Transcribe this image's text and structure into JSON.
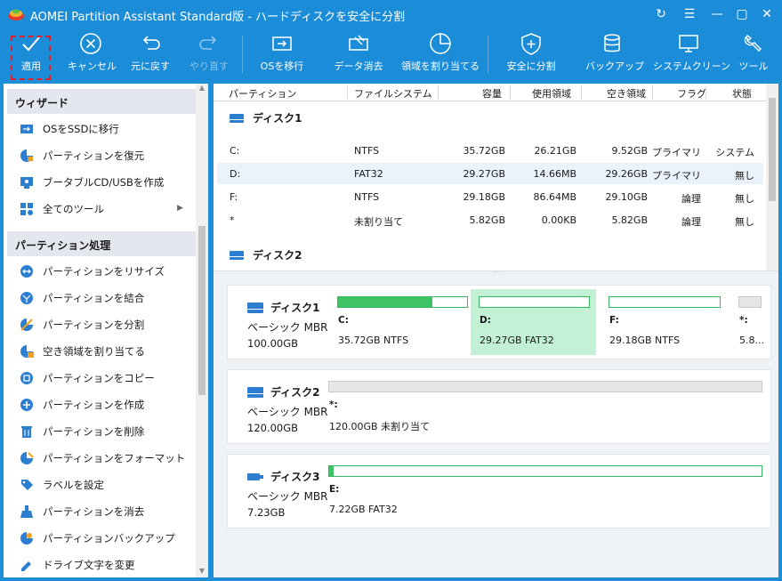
{
  "window": {
    "title": "AOMEI Partition Assistant Standard版 - ハードディスクを安全に分割",
    "brand_color": "#1b8cd8",
    "buttons": [
      "refresh-icon",
      "menu-icon",
      "minimize-icon",
      "maximize-icon",
      "close-icon"
    ]
  },
  "toolbar": {
    "apply": "適用",
    "cancel": "キャンセル",
    "undo": "元に戻す",
    "redo": "やり直す",
    "migrate_os": "OSを移行",
    "wipe_data": "データ消去",
    "allocate_space": "領域を割り当てる",
    "safe_split": "安全に分割",
    "backup": "バックアップ",
    "system_clean": "システムクリーン",
    "tools": "ツール"
  },
  "sidebar": {
    "wizard_title": "ウィザード",
    "wizard_items": [
      {
        "label": "OSをSSDに移行",
        "icon": "migrate-icon"
      },
      {
        "label": "パーティションを復元",
        "icon": "recover-icon"
      },
      {
        "label": "ブータブルCD/USBを作成",
        "icon": "bootable-icon"
      },
      {
        "label": "全てのツール",
        "icon": "tools-grid-icon"
      }
    ],
    "partition_title": "パーティション処理",
    "partition_items": [
      {
        "label": "パーティションをリサイズ",
        "icon": "resize-icon"
      },
      {
        "label": "パーティションを結合",
        "icon": "merge-icon"
      },
      {
        "label": "パーティションを分割",
        "icon": "split-icon"
      },
      {
        "label": "空き領域を割り当てる",
        "icon": "allocate-icon"
      },
      {
        "label": "パーティションをコピー",
        "icon": "copy-icon"
      },
      {
        "label": "パーティションを作成",
        "icon": "create-icon"
      },
      {
        "label": "パーティションを削除",
        "icon": "delete-icon"
      },
      {
        "label": "パーティションをフォーマット",
        "icon": "format-icon"
      },
      {
        "label": "ラベルを設定",
        "icon": "label-icon"
      },
      {
        "label": "パーティションを消去",
        "icon": "wipe-icon"
      },
      {
        "label": "パーティションバックアップ",
        "icon": "backup-icon"
      },
      {
        "label": "ドライブ文字を変更",
        "icon": "drive-letter-icon"
      }
    ]
  },
  "table": {
    "headers": {
      "partition": "パーティション",
      "filesystem": "ファイルシステム",
      "capacity": "容量",
      "used": "使用領域",
      "free": "空き領域",
      "flag": "フラグ",
      "status": "状態"
    },
    "disk1_label": "ディスク1",
    "disk2_label": "ディスク2",
    "rows": [
      {
        "partition": "C:",
        "fs": "NTFS",
        "capacity": "35.72GB",
        "used": "26.21GB",
        "free": "9.52GB",
        "flag": "プライマリ",
        "status": "システム"
      },
      {
        "partition": "D:",
        "fs": "FAT32",
        "capacity": "29.27GB",
        "used": "14.66MB",
        "free": "29.26GB",
        "flag": "プライマリ",
        "status": "無し"
      },
      {
        "partition": "F:",
        "fs": "NTFS",
        "capacity": "29.18GB",
        "used": "86.64MB",
        "free": "29.10GB",
        "flag": "論理",
        "status": "無し"
      },
      {
        "partition": "*",
        "fs": "未割り当て",
        "capacity": "5.82GB",
        "used": "0.00KB",
        "free": "5.82GB",
        "flag": "論理",
        "status": "無し"
      }
    ]
  },
  "disks": [
    {
      "name": "ディスク1",
      "type": "ベーシック MBR",
      "size": "100.00GB",
      "partitions": [
        {
          "letter": "C:",
          "detail": "35.72GB NTFS",
          "used_fraction": 0.73
        },
        {
          "letter": "D:",
          "detail": "29.27GB FAT32",
          "used_fraction": 0.0
        },
        {
          "letter": "F:",
          "detail": "29.18GB NTFS",
          "used_fraction": 0.0
        },
        {
          "letter": "*:",
          "detail": "5.8...",
          "used_fraction": 0.0
        }
      ]
    },
    {
      "name": "ディスク2",
      "type": "ベーシック MBR",
      "size": "120.00GB",
      "partitions": [
        {
          "letter": "*:",
          "detail": "120.00GB 未割り当て",
          "used_fraction": 0.0
        }
      ]
    },
    {
      "name": "ディスク3",
      "type": "ベーシック MBR",
      "size": "7.23GB",
      "partitions": [
        {
          "letter": "E:",
          "detail": "7.22GB FAT32",
          "used_fraction": 0.01
        }
      ]
    }
  ]
}
